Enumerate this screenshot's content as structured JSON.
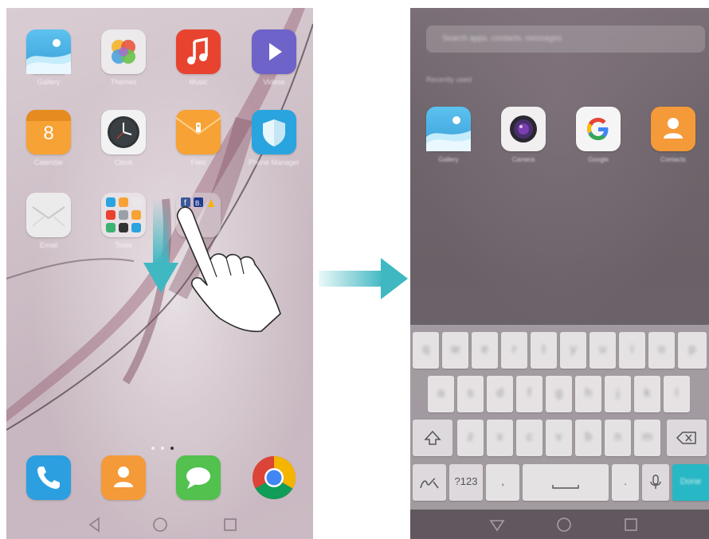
{
  "left_screen": {
    "apps": [
      {
        "name": "gallery",
        "label": "Gallery"
      },
      {
        "name": "themes",
        "label": "Themes"
      },
      {
        "name": "music",
        "label": "Music"
      },
      {
        "name": "videos",
        "label": "Videos"
      },
      {
        "name": "calendar",
        "label": "Calendar",
        "date": "8"
      },
      {
        "name": "clock",
        "label": "Clock"
      },
      {
        "name": "files",
        "label": "Files"
      },
      {
        "name": "phone-manager",
        "label": "Phone Manager"
      },
      {
        "name": "email",
        "label": "Email"
      },
      {
        "name": "tools-folder",
        "label": "Tools"
      },
      {
        "name": "social-folder",
        "label": ""
      }
    ],
    "dock": [
      {
        "name": "phone",
        "label": ""
      },
      {
        "name": "contacts",
        "label": ""
      },
      {
        "name": "messages",
        "label": ""
      },
      {
        "name": "chrome",
        "label": ""
      }
    ],
    "pager": {
      "pages": 3,
      "active": 2
    },
    "gesture": "swipe-down"
  },
  "right_screen": {
    "search": {
      "placeholder": "Search apps, contacts, messages"
    },
    "recent_label": "Recently used",
    "recent_apps": [
      {
        "name": "gallery",
        "label": "Gallery"
      },
      {
        "name": "camera",
        "label": "Camera"
      },
      {
        "name": "google",
        "label": "Google"
      },
      {
        "name": "contacts",
        "label": "Contacts"
      }
    ],
    "keyboard": {
      "row1": [
        "q",
        "w",
        "e",
        "r",
        "t",
        "y",
        "u",
        "i",
        "o",
        "p"
      ],
      "row2": [
        "a",
        "s",
        "d",
        "f",
        "g",
        "h",
        "j",
        "k",
        "l"
      ],
      "row3": [
        "z",
        "x",
        "c",
        "v",
        "b",
        "n",
        "m"
      ],
      "symbols_key": "?123",
      "comma_key": ",",
      "period_key": ".",
      "done_key": "Done"
    }
  },
  "colors": {
    "accent_teal": "#3fb8c2",
    "done_key": "#28b7c4"
  },
  "icons": [
    "back-icon",
    "home-icon",
    "recents-icon",
    "shift-icon",
    "backspace-icon",
    "handwriting-icon",
    "microphone-icon",
    "space-icon"
  ]
}
